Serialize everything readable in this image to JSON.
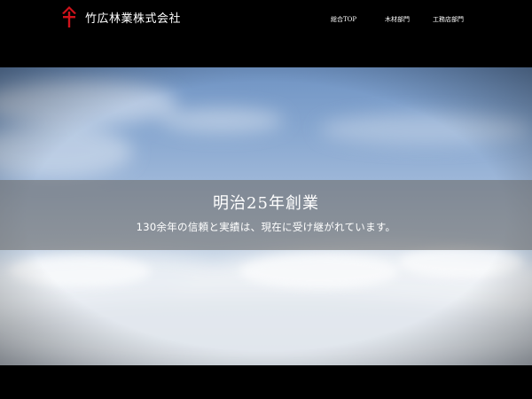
{
  "brand": {
    "name": "竹広林業株式会社",
    "logo_icon": "company-crest-icon",
    "logo_color": "#d0121b"
  },
  "nav": {
    "items": [
      {
        "label": "総合TOP"
      },
      {
        "label": "木材部門"
      },
      {
        "label": "工務店部門"
      }
    ]
  },
  "hero": {
    "headline": "明治25年創業",
    "subline": "130余年の信頼と実績は、現在に受け継がれています。"
  },
  "colors": {
    "background": "#000000",
    "text": "#ffffff",
    "band": "#6e6e6e"
  }
}
